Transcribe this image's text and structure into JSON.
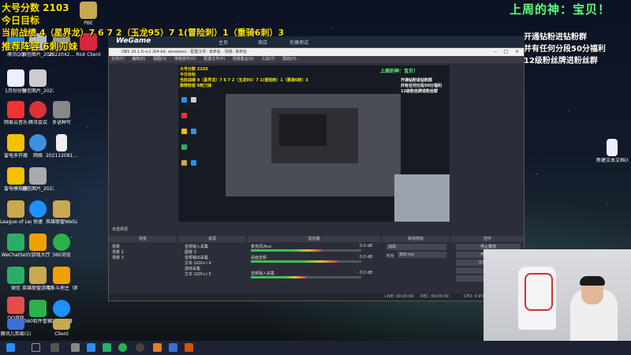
{
  "overlay": {
    "line1": "大号分数 2103",
    "line2": "今日目标",
    "line3": "当前战绩 4（星界龙）7 6 7 2（玉龙95）7 1(冒险刺）1（重骑6刺）3",
    "line4": "推荐阵容 6刺刀妹",
    "right_title": "上周的神：宝贝！",
    "right_lines": [
      "开通钻粉进钻粉群",
      "并有任何分段50分福利",
      "12级粉丝牌进粉丝群"
    ]
  },
  "desktop_icons": [
    {
      "label": "腾讯QQ"
    },
    {
      "label": "1月份份份"
    },
    {
      "label": "网易云音乐"
    },
    {
      "label": "雷电多开器"
    },
    {
      "label": "雷电模拟器"
    },
    {
      "label": "League of Legends"
    },
    {
      "label": "WeChatSe..."
    },
    {
      "label": "微信"
    },
    {
      "label": "QQ游戏"
    },
    {
      "label": "腾讯儿到易(1)"
    },
    {
      "label": "微信图片_2022042..."
    },
    {
      "label": "微信图片_20220..."
    },
    {
      "label": "腾讯会议"
    },
    {
      "label": "网络"
    },
    {
      "label": "微信图片_20220..."
    },
    {
      "label": "快速"
    },
    {
      "label": "YY游戏大厅"
    },
    {
      "label": "英雄联盟游戏中心"
    },
    {
      "label": "360软件管家"
    },
    {
      "label": "PBE"
    },
    {
      "label": "Riot Client"
    },
    {
      "label": "2022042..."
    },
    {
      "label": "多语种写"
    },
    {
      "label": "202112081..."
    },
    {
      "label": "英雄联盟WeGame版"
    },
    {
      "label": "360浏览"
    },
    {
      "label": "欢乐斗地主（腾讯游戏）"
    },
    {
      "label": "QQ浏览器"
    },
    {
      "label": "Client"
    },
    {
      "label": "新建文本文档(8)"
    }
  ],
  "wegame": {
    "brand": "WeGame",
    "tabs": [
      "主页",
      "商店",
      "先锋测试"
    ]
  },
  "obs": {
    "title": "OBS 26.1.0-rc1 (64-bit, windows) - 配置文件: 未命名 - 场景: 未命名",
    "menu": [
      "文件(F)",
      "编辑(E)",
      "视图(V)",
      "停靠部件(D)",
      "配置文件(P)",
      "场景集合(S)",
      "工具(T)",
      "帮助(H)"
    ],
    "preview_overlay_yellow": [
      "大号分数 2103",
      "今日目标",
      "当前战绩 4（星界龙）7 6 7 2（玉龙95）7 1(冒险刺）1（重骑6刺）3",
      "推荐阵容 6刺刀妹"
    ],
    "preview_overlay_green": "上周的神：宝贝！",
    "preview_overlay_right": [
      "开通钻粉进钻粉群",
      "并有任何分段50分福利",
      "12级粉丝牌进粉丝群"
    ],
    "scene_state": "未选择源",
    "docks": {
      "scenes": "场景",
      "sources": "来源",
      "mixer": "混音器",
      "transitions": "转场特效",
      "controls": "控件"
    },
    "scenes": [
      "场景",
      "场景 2",
      "场景 3"
    ],
    "sources": [
      "音频输入采集",
      "图像 3",
      "音频输出采集",
      "文本 (GDI+) 4",
      "游戏采集",
      "文本 (GDI+) 5"
    ],
    "mixer": [
      {
        "name": "麦克风/Aux",
        "db": "0.0 dB"
      },
      {
        "name": "桌面音频",
        "db": "0.0 dB"
      },
      {
        "name": "音频输入采集",
        "db": "0.0 dB"
      }
    ],
    "transition": {
      "type": "淡出",
      "duration_label": "时长",
      "duration": "300 ms"
    },
    "controls": [
      "停止推流",
      "开始录制",
      "工作室模式",
      "设置",
      "退出"
    ],
    "status": {
      "live": "LIVE: 00:00:00",
      "rec": "REC: 00:00:00",
      "cpu": "CPU: 0.9%, 30.00 fps"
    }
  },
  "colors": {
    "overlay_yellow": "#ffe400",
    "overlay_green": "#5dff7a",
    "obs_bg": "#2b2e38",
    "taskbar": "#1c2233"
  }
}
